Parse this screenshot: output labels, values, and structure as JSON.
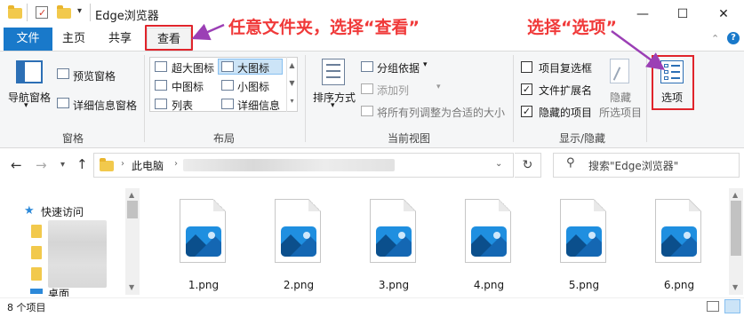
{
  "window": {
    "title": "Edge浏览器",
    "controls": {
      "minimize": "—",
      "maximize": "☐",
      "close": "✕"
    }
  },
  "ribbon_tabs": [
    {
      "label": "文件",
      "active": false,
      "accent": "#1979ca"
    },
    {
      "label": "主页",
      "active": false
    },
    {
      "label": "共享",
      "active": false
    },
    {
      "label": "查看",
      "active": true
    }
  ],
  "ribbon": {
    "panes": {
      "nav_pane": "导航窗格",
      "preview_pane": "预览窗格",
      "details_pane": "详细信息窗格",
      "group_label": "窗格"
    },
    "layout": {
      "items": [
        "超大图标",
        "大图标",
        "中图标",
        "小图标",
        "列表",
        "详细信息"
      ],
      "selected": "大图标",
      "group_label": "布局"
    },
    "current_view": {
      "sort": "排序方式",
      "group_by": "分组依据",
      "add_column": "添加列",
      "size_all": "将所有列调整为合适的大小",
      "group_label": "当前视图"
    },
    "show_hide": {
      "item_checkboxes": {
        "label": "项目复选框",
        "checked": false
      },
      "file_extensions": {
        "label": "文件扩展名",
        "checked": true
      },
      "hidden_items": {
        "label": "隐藏的项目",
        "checked": true
      },
      "hide_selected_a": "隐藏",
      "hide_selected_b": "所选项目",
      "group_label": "显示/隐藏"
    },
    "options": {
      "label": "选项"
    }
  },
  "nav": {
    "address_root": "此电脑",
    "search_placeholder": "搜索\"Edge浏览器\"",
    "quick_access": "快速访问",
    "desktop": "桌面"
  },
  "files": [
    "1.png",
    "2.png",
    "3.png",
    "4.png",
    "5.png",
    "6.png"
  ],
  "status": {
    "count": "8 个项目"
  },
  "annotations": {
    "view_hint": "任意文件夹，选择“查看”",
    "options_hint": "选择“选项”",
    "color": "#f03a3a",
    "arrow_color": "#9b3fb5"
  }
}
